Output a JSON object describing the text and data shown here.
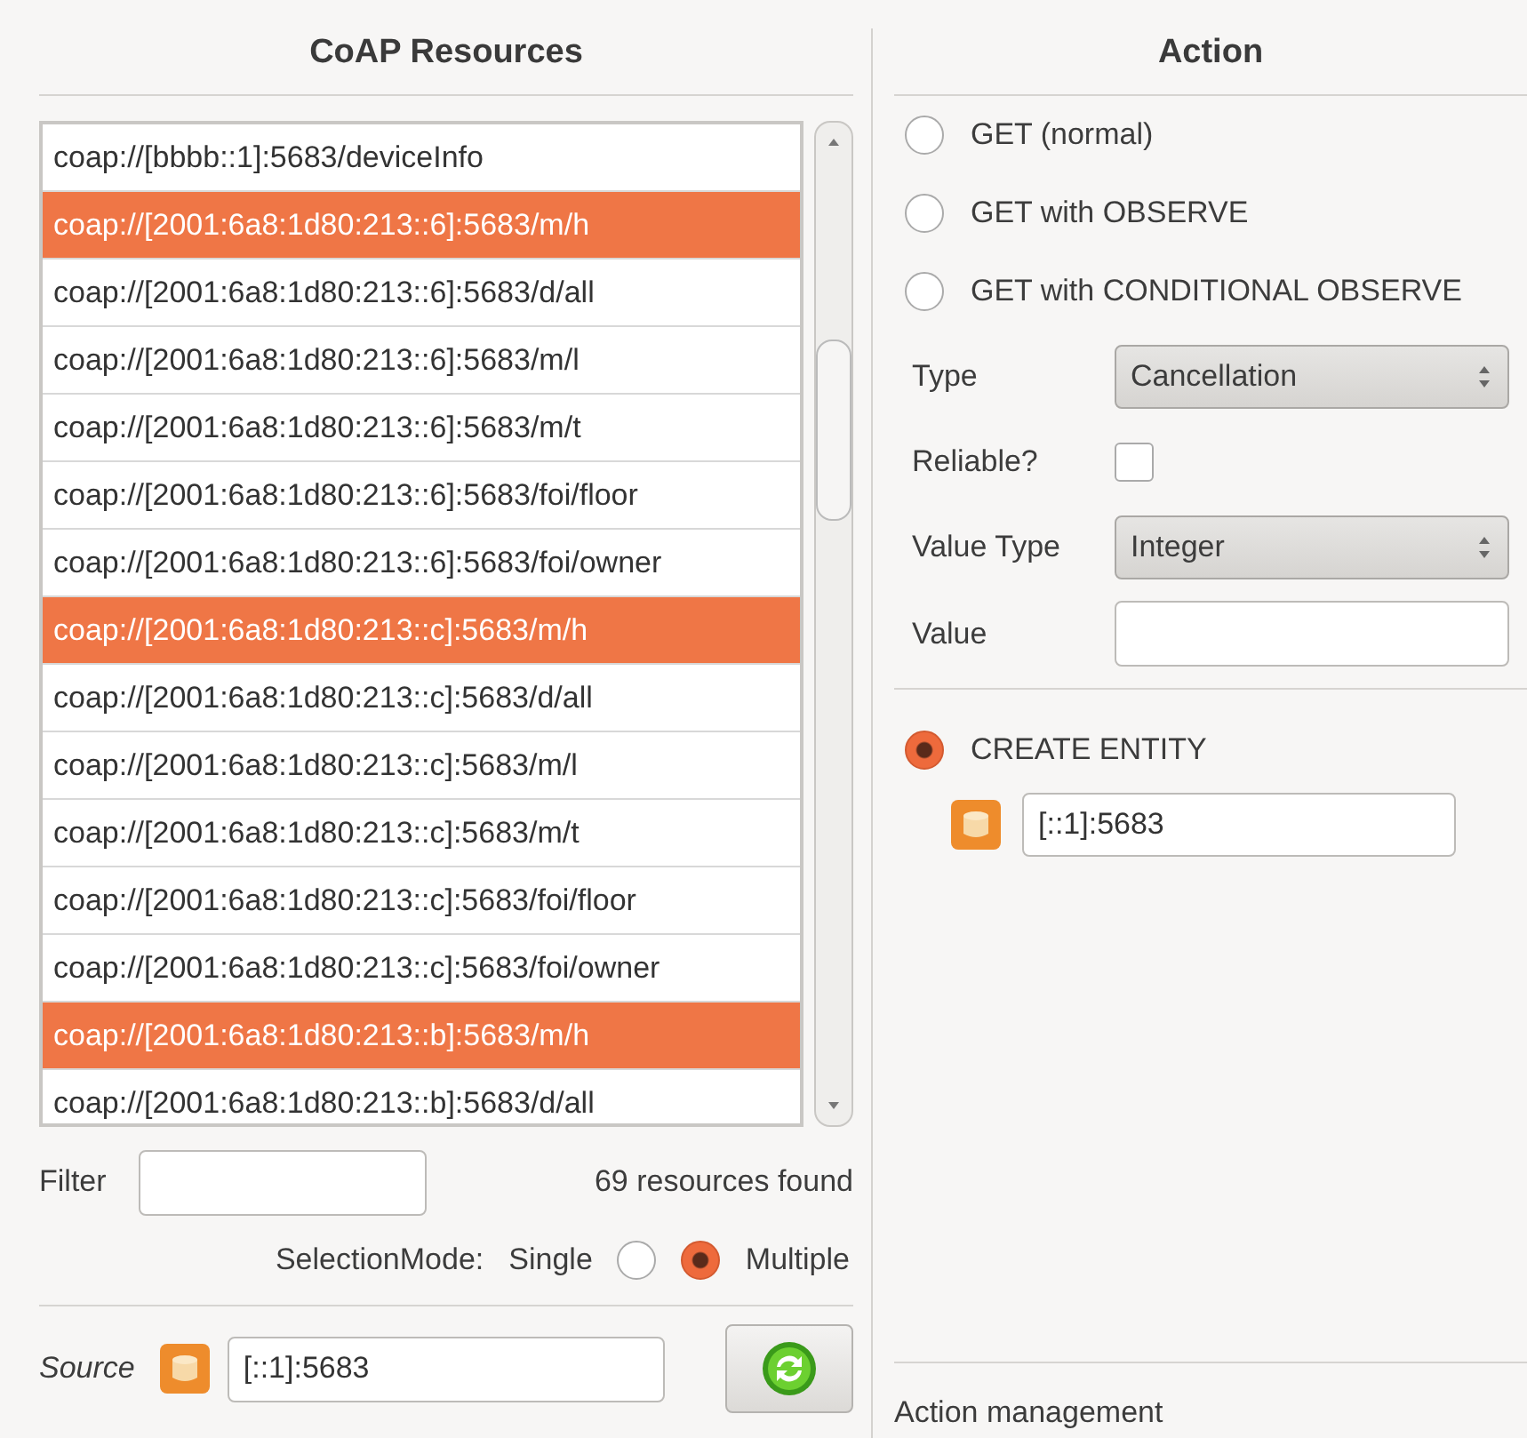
{
  "resources_panel": {
    "title": "CoAP Resources",
    "resources": [
      {
        "uri": "coap://[bbbb::1]:5683/deviceInfo",
        "selected": false
      },
      {
        "uri": "coap://[2001:6a8:1d80:213::6]:5683/m/h",
        "selected": true
      },
      {
        "uri": "coap://[2001:6a8:1d80:213::6]:5683/d/all",
        "selected": false
      },
      {
        "uri": "coap://[2001:6a8:1d80:213::6]:5683/m/l",
        "selected": false
      },
      {
        "uri": "coap://[2001:6a8:1d80:213::6]:5683/m/t",
        "selected": false
      },
      {
        "uri": "coap://[2001:6a8:1d80:213::6]:5683/foi/floor",
        "selected": false
      },
      {
        "uri": "coap://[2001:6a8:1d80:213::6]:5683/foi/owner",
        "selected": false
      },
      {
        "uri": "coap://[2001:6a8:1d80:213::c]:5683/m/h",
        "selected": true
      },
      {
        "uri": "coap://[2001:6a8:1d80:213::c]:5683/d/all",
        "selected": false
      },
      {
        "uri": "coap://[2001:6a8:1d80:213::c]:5683/m/l",
        "selected": false
      },
      {
        "uri": "coap://[2001:6a8:1d80:213::c]:5683/m/t",
        "selected": false
      },
      {
        "uri": "coap://[2001:6a8:1d80:213::c]:5683/foi/floor",
        "selected": false
      },
      {
        "uri": "coap://[2001:6a8:1d80:213::c]:5683/foi/owner",
        "selected": false
      },
      {
        "uri": "coap://[2001:6a8:1d80:213::b]:5683/m/h",
        "selected": true
      },
      {
        "uri": "coap://[2001:6a8:1d80:213::b]:5683/d/all",
        "selected": false
      }
    ],
    "filter_label": "Filter",
    "count": "69 resources found",
    "selection_mode": {
      "label": "SelectionMode:",
      "options": [
        {
          "label": "Single",
          "selected": false
        },
        {
          "label": "Multiple",
          "selected": true
        }
      ]
    },
    "source_label": "Source",
    "source_value": "[::1]:5683"
  },
  "action_panel": {
    "title": "Action",
    "actions": [
      {
        "label": "GET (normal)",
        "selected": false
      },
      {
        "label": "GET with OBSERVE",
        "selected": false
      },
      {
        "label": "GET with CONDITIONAL OBSERVE",
        "selected": false
      }
    ],
    "fields": [
      {
        "kind": "select",
        "label": "Type",
        "value": "Cancellation"
      },
      {
        "kind": "checkbox",
        "label": "Reliable?",
        "checked": false
      },
      {
        "kind": "select",
        "label": "Value Type",
        "value": "Integer"
      },
      {
        "kind": "text",
        "label": "Value"
      }
    ],
    "create": {
      "label": "CREATE ENTITY",
      "selected": true
    },
    "entity_source": "[::1]:5683",
    "footer": "Action management"
  }
}
